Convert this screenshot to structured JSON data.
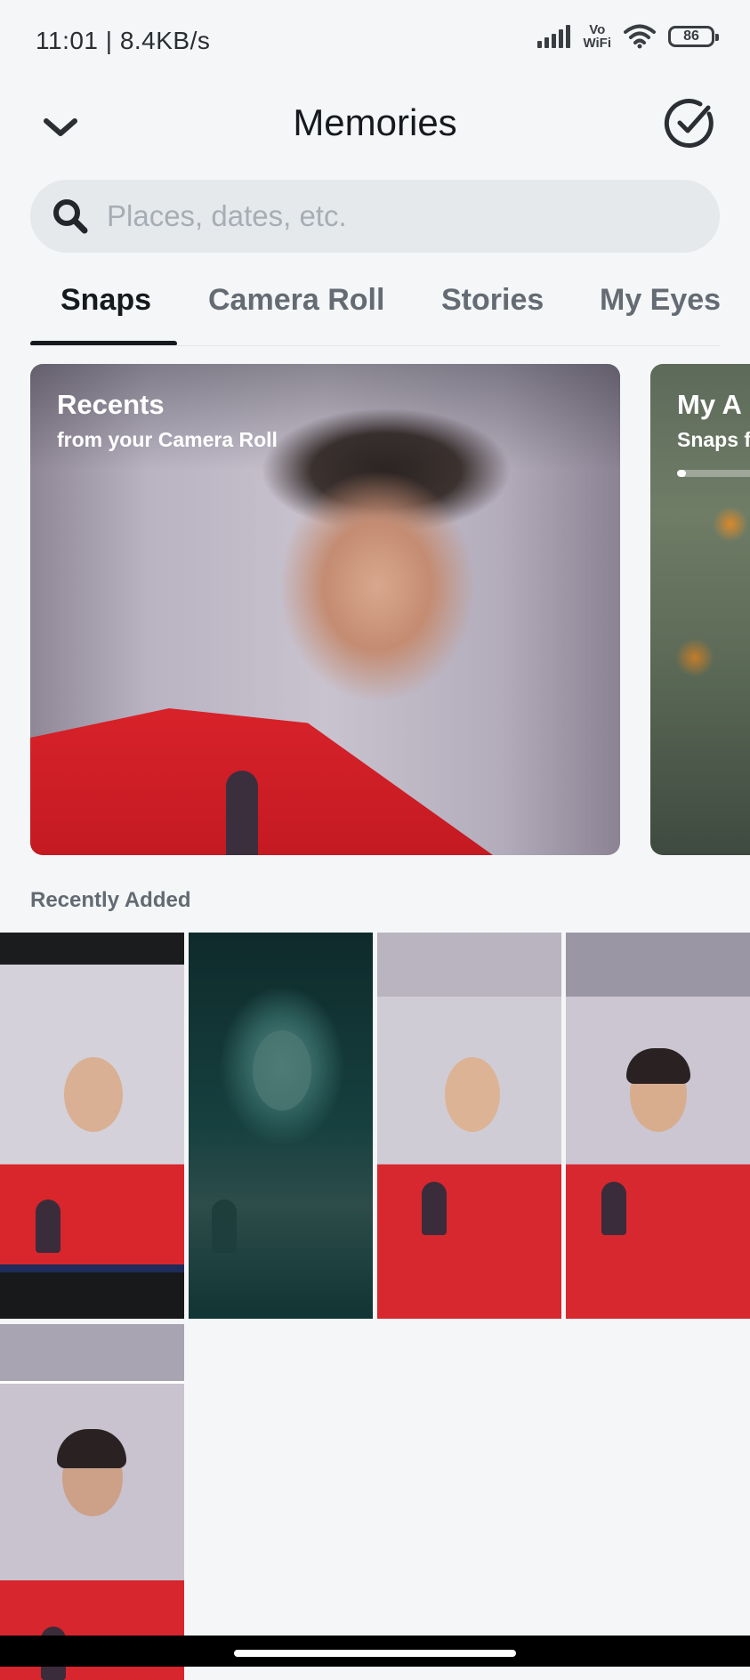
{
  "status_bar": {
    "time": "11:01 | 8.4KB/s",
    "network_label_top": "Vo",
    "network_label_bottom": "WiFi",
    "battery": "86"
  },
  "header": {
    "title": "Memories",
    "back_icon": "chevron-down-icon",
    "select_icon": "check-circle-icon"
  },
  "search": {
    "placeholder": "Places, dates, etc.",
    "value": "",
    "icon": "search-icon"
  },
  "tabs": [
    {
      "label": "Snaps",
      "active": true
    },
    {
      "label": "Camera Roll",
      "active": false
    },
    {
      "label": "Stories",
      "active": false
    },
    {
      "label": "My Eyes",
      "active": false
    }
  ],
  "cards": [
    {
      "title": "Recents",
      "subtitle": "from your Camera Roll"
    },
    {
      "title": "My A",
      "subtitle": "Snaps f",
      "progress": 0.08
    }
  ],
  "recently_added": {
    "title": "Recently Added",
    "count": 5
  },
  "colors": {
    "background": "#f4f6f8",
    "text_primary": "#16191d",
    "text_secondary": "#646b73",
    "search_bg": "#e6e9ec"
  }
}
